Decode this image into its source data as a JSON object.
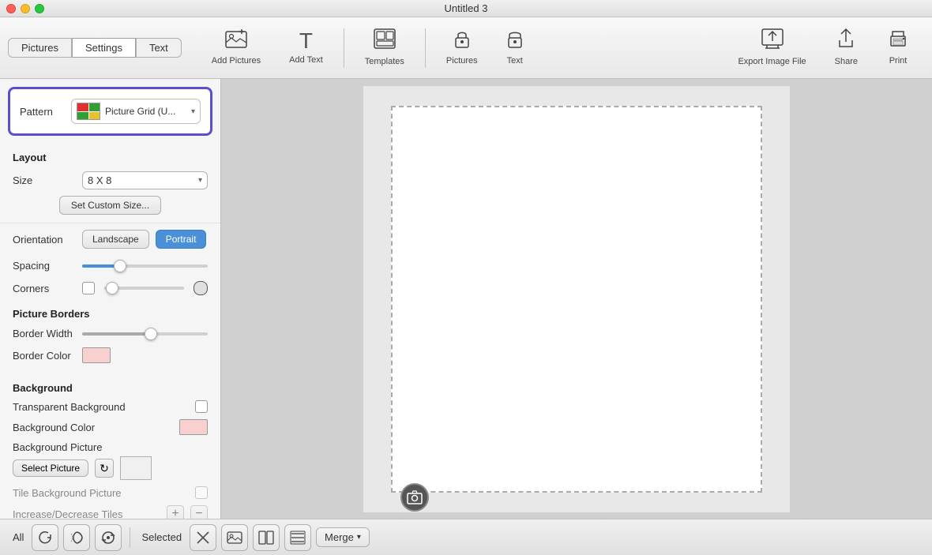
{
  "window": {
    "title": "Untitled 3",
    "traffic_lights": [
      "close",
      "minimize",
      "maximize"
    ]
  },
  "toolbar": {
    "tabs": [
      {
        "id": "pictures",
        "label": "Pictures",
        "active": false
      },
      {
        "id": "settings",
        "label": "Settings",
        "active": true
      },
      {
        "id": "text",
        "label": "Text",
        "active": false
      }
    ],
    "groups": [
      {
        "id": "add-pictures",
        "icon": "🖼",
        "label": "Add Pictures"
      },
      {
        "id": "add-text",
        "icon": "T",
        "label": "Add Text"
      },
      {
        "id": "templates",
        "icon": "⊞",
        "label": "Templates"
      },
      {
        "id": "pictures-lock",
        "icon": "🔒",
        "label": "Pictures"
      },
      {
        "id": "text-lock",
        "icon": "🔒",
        "label": "Text"
      },
      {
        "id": "export",
        "icon": "⬆",
        "label": "Export Image File"
      },
      {
        "id": "share",
        "icon": "⬆",
        "label": "Share"
      },
      {
        "id": "print",
        "icon": "🖨",
        "label": "Print"
      }
    ]
  },
  "sidebar": {
    "pattern": {
      "label": "Pattern",
      "value": "Picture Grid (U...",
      "icon": "grid"
    },
    "layout": {
      "title": "Layout",
      "size_label": "Size",
      "size_value": "8 X 8",
      "custom_size_btn": "Set Custom Size..."
    },
    "orientation": {
      "label": "Orientation",
      "landscape": "Landscape",
      "portrait": "Portrait",
      "active": "Portrait"
    },
    "spacing": {
      "label": "Spacing",
      "value": 30
    },
    "corners": {
      "label": "Corners",
      "value": 0
    },
    "picture_borders": {
      "title": "Picture Borders",
      "border_width_label": "Border Width",
      "border_color_label": "Border Color"
    },
    "background": {
      "title": "Background",
      "transparent_label": "Transparent Background",
      "bg_color_label": "Background Color",
      "bg_picture_label": "Background Picture",
      "select_btn": "Select Picture",
      "tile_label": "Tile Background Picture",
      "inc_dec_label": "Increase/Decrease Tiles"
    }
  },
  "bottom_toolbar": {
    "all_label": "All",
    "selected_label": "Selected",
    "merge_label": "Merge"
  }
}
